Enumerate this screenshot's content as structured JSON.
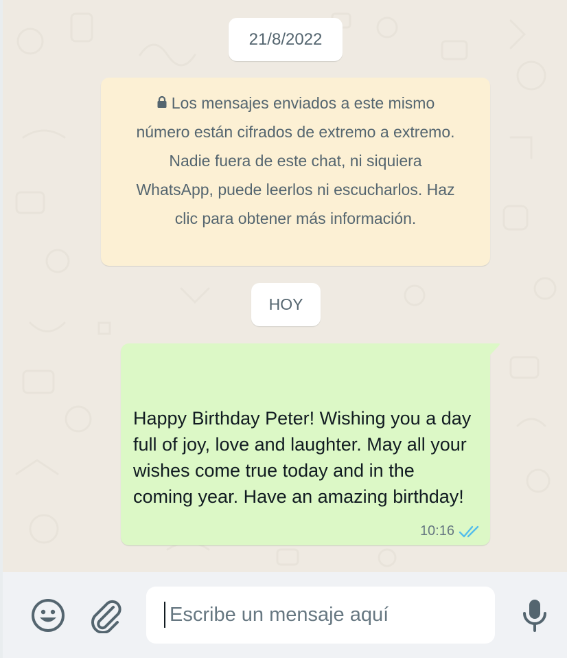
{
  "chat": {
    "date_chip": "21/8/2022",
    "encryption_notice": "Los mensajes enviados a este mismo número están cifrados de extremo a extremo. Nadie fuera de este chat, ni siquiera WhatsApp, puede leerlos ni escucharlos. Haz clic para obtener más información.",
    "today_chip": "HOY",
    "messages": [
      {
        "direction": "outgoing",
        "text": "Happy Birthday Peter! Wishing you a day full of joy, love and laughter. May all your wishes come true today and in the coming year. Have an amazing birthday!",
        "time": "10:16",
        "status": "read",
        "status_icon": "double-check-icon"
      }
    ]
  },
  "footer": {
    "emoji_icon": "smiley-icon",
    "attach_icon": "paperclip-icon",
    "input_placeholder": "Escribe un mensaje aquí",
    "mic_icon": "microphone-icon"
  },
  "colors": {
    "chat_background": "#efeae2",
    "outgoing_bubble": "#dcf8c6",
    "notice_background": "#fcf0d4",
    "read_ticks": "#53bdeb",
    "footer_background": "#f0f2f5"
  }
}
